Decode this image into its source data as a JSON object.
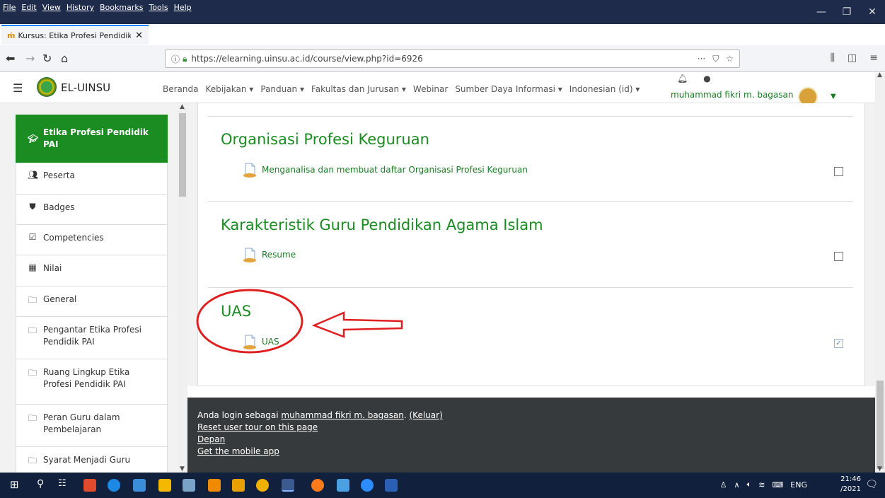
{
  "browser": {
    "menus": [
      "File",
      "Edit",
      "View",
      "History",
      "Bookmarks",
      "Tools",
      "Help"
    ],
    "tab_title": "Kursus: Etika Profesi Pendidik P",
    "url": "https://elearning.uinsu.ac.id/course/view.php?id=6926"
  },
  "site": {
    "brand": "EL-UINSU",
    "menu": [
      "Beranda",
      "Kebijakan ▾",
      "Panduan ▾",
      "Fakultas dan Jurusan ▾",
      "Webinar",
      "Sumber Daya Informasi ▾",
      "Indonesian (id) ▾"
    ],
    "user_name": "muhammad fikri m. bagasan"
  },
  "sidebar": {
    "items": [
      {
        "label": "Etika Profesi Pendidik PAI",
        "icon": "graduation-cap-icon"
      },
      {
        "label": "Peserta",
        "icon": "users-icon"
      },
      {
        "label": "Badges",
        "icon": "shield-icon"
      },
      {
        "label": "Competencies",
        "icon": "checkbox-icon"
      },
      {
        "label": "Nilai",
        "icon": "table-icon"
      },
      {
        "label": "General",
        "icon": "folder-icon"
      },
      {
        "label": "Pengantar Etika Profesi Pendidik PAI",
        "icon": "folder-icon"
      },
      {
        "label": "Ruang Lingkup Etika Profesi Pendidik PAI",
        "icon": "folder-icon"
      },
      {
        "label": "Peran Guru dalam Pembelajaran",
        "icon": "folder-icon"
      },
      {
        "label": "Syarat Menjadi Guru",
        "icon": "folder-icon"
      }
    ]
  },
  "sections": [
    {
      "title": "Organisasi Profesi Keguruan",
      "activity": "Menganalisa dan membuat daftar Organisasi Profesi Keguruan",
      "completed": false
    },
    {
      "title": "Karakteristik Guru Pendidikan Agama Islam",
      "activity": "Resume",
      "completed": false
    },
    {
      "title": "UAS",
      "activity": "UAS",
      "completed": true
    }
  ],
  "footer": {
    "login_prefix": "Anda login sebagai ",
    "login_user": "muhammad fikri m. bagasan",
    "login_sep": ". ",
    "logout": "(Keluar)",
    "reset_tour": "Reset user tour on this page",
    "home": "Depan",
    "mobile_app": "Get the mobile app"
  },
  "taskbar": {
    "time": "21:46",
    "date": "/2021",
    "lang": "ENG"
  },
  "colors": {
    "accent_green": "#1a8c22",
    "annotation_red": "#e02020",
    "footer_bg": "#373a3c"
  }
}
